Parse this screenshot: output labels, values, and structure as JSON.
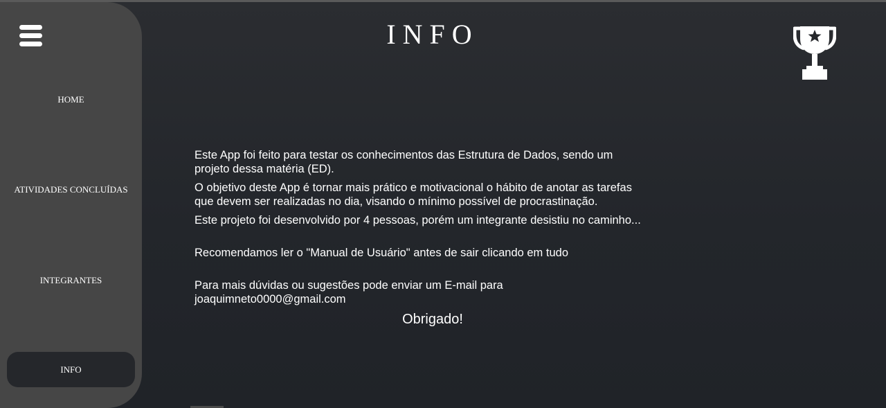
{
  "app": {
    "title": "INFO"
  },
  "sidebar": {
    "menu_icon": "hamburger-menu-icon",
    "items": [
      {
        "label": "HOME",
        "active": false
      },
      {
        "label": "ATIVIDADES CONCLUÍDAS",
        "active": false
      },
      {
        "label": "INTEGRANTES",
        "active": false
      },
      {
        "label": "INFO",
        "active": true
      }
    ]
  },
  "header": {
    "trophy_icon": "trophy-star-icon"
  },
  "main": {
    "paragraphs": [
      "Este App foi feito para testar os conhecimentos das Estrutura de Dados, sendo um\nprojeto dessa matéria (ED).",
      "O objetivo deste App é tornar mais prático e motivacional o hábito de anotar as tarefas\nque devem ser realizadas no dia, visando o mínimo possível de procrastinação.",
      "Este projeto foi desenvolvido por 4 pessoas, porém um integrante desistiu no caminho...",
      "Recomendamos ler o \"Manual de Usuário\" antes de sair clicando em tudo",
      "Para mais dúvidas ou sugestões pode enviar um E-mail para\njoaquimneto0000@gmail.com"
    ],
    "thanks": "Obrigado!"
  },
  "colors": {
    "background": "#25272b",
    "sidebar": "#464646",
    "active_item": "#25272b",
    "text": "#ffffff"
  }
}
